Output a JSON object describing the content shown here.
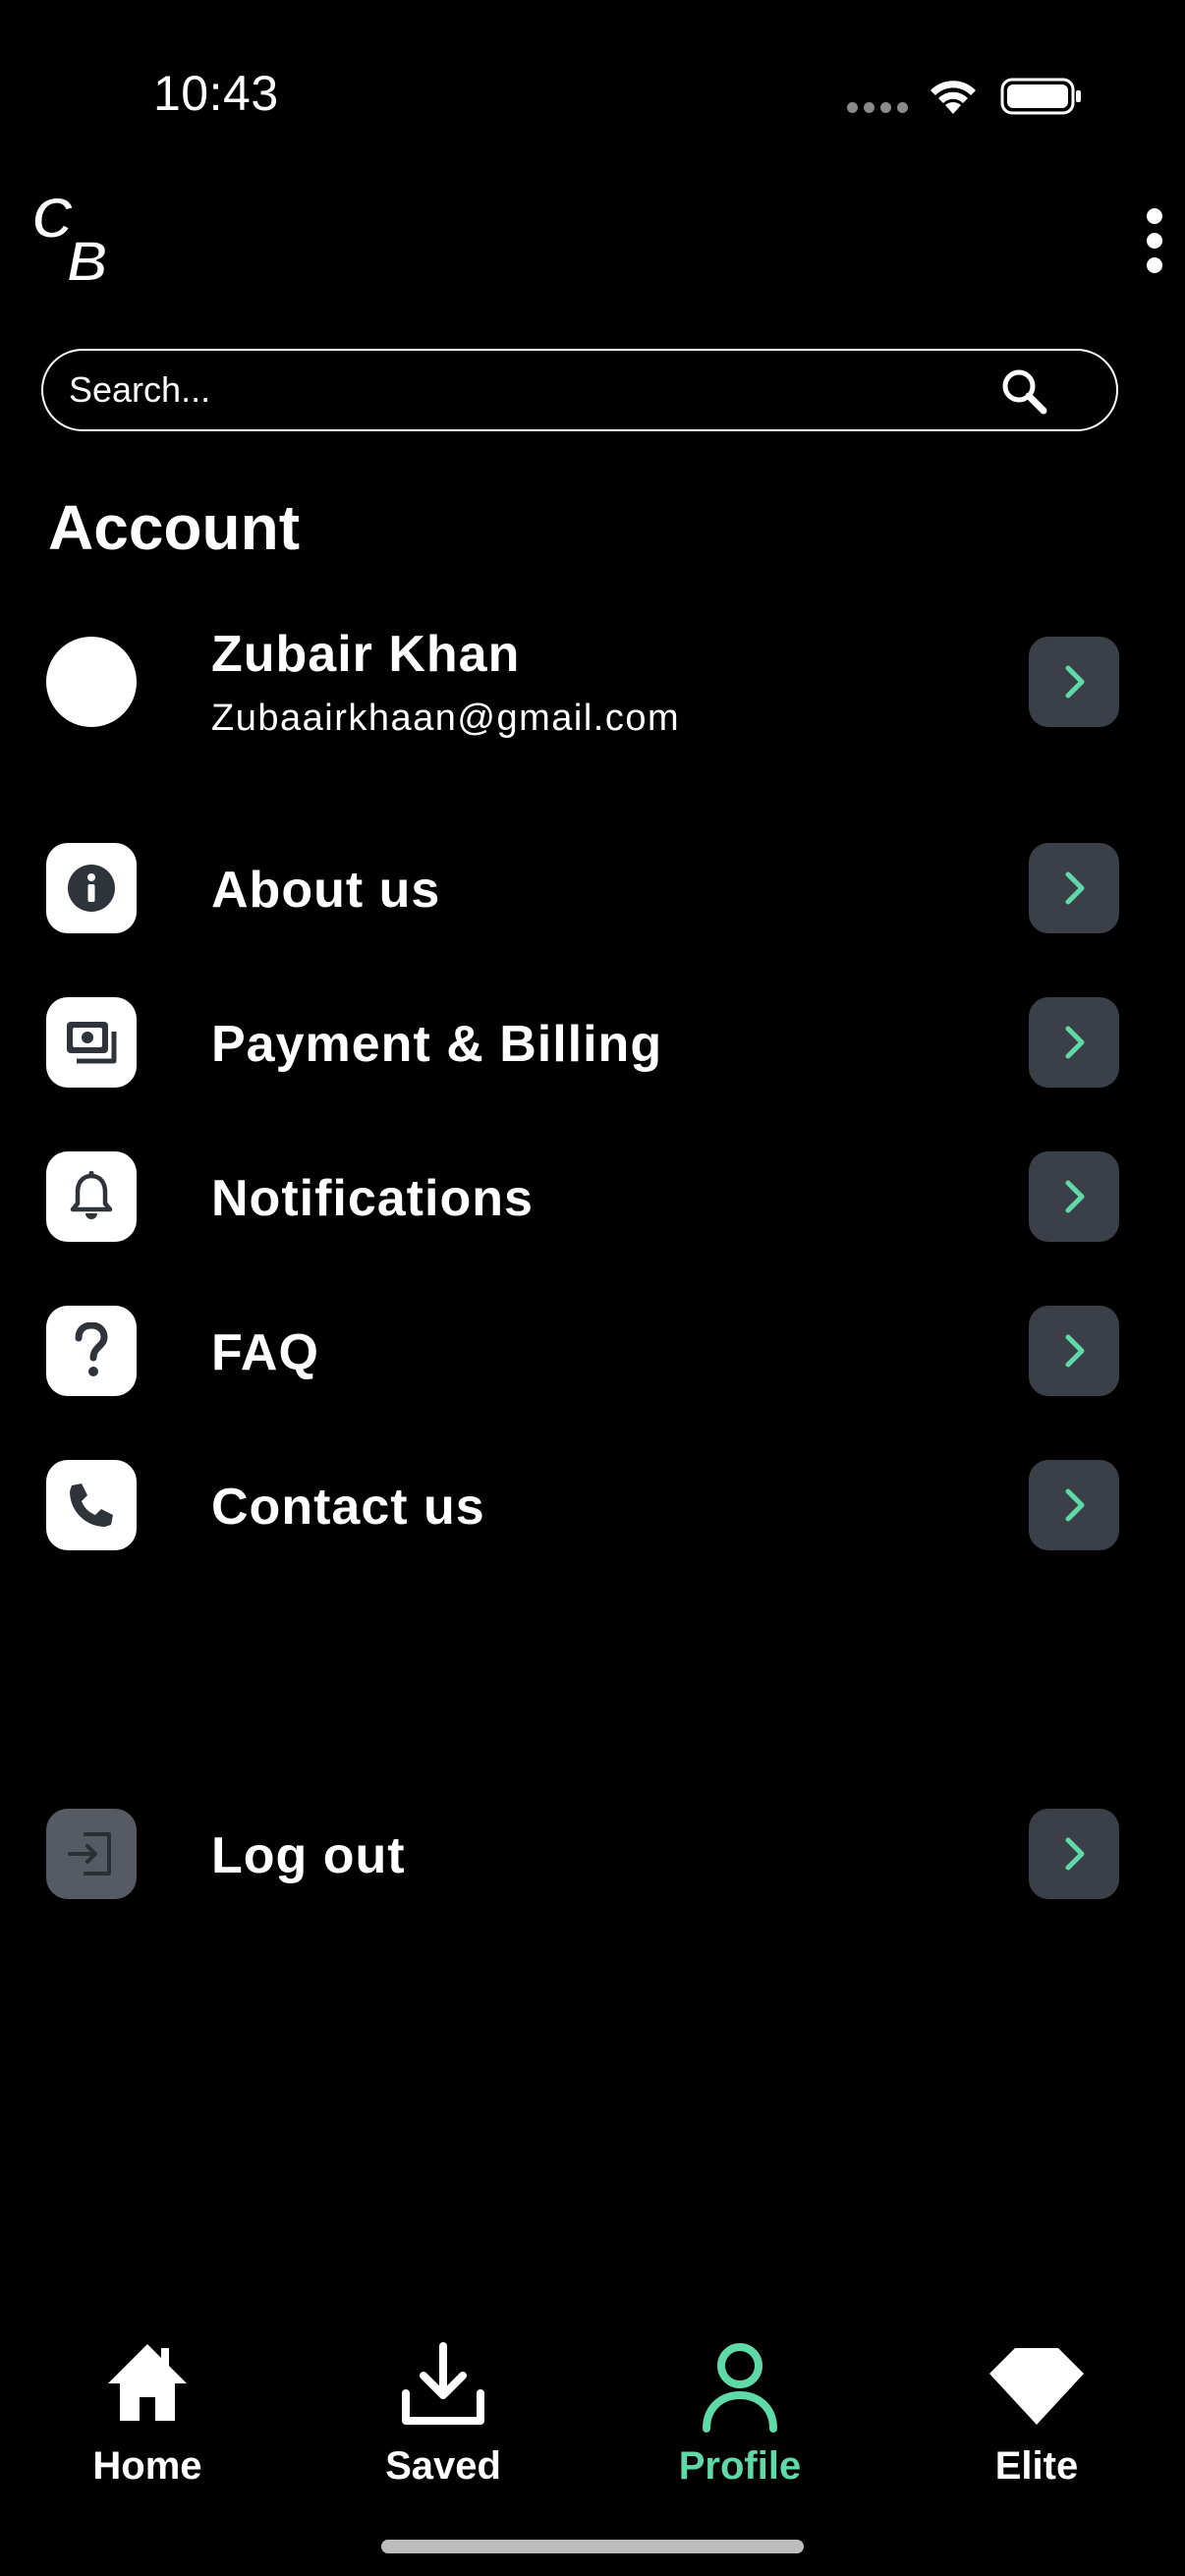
{
  "status_bar": {
    "time": "10:43"
  },
  "header": {
    "logo_icon": "cb-logo-icon",
    "more_icon": "more-vertical-icon"
  },
  "search": {
    "placeholder": "Search..."
  },
  "section": {
    "title": "Account"
  },
  "profile": {
    "name": "Zubair Khan",
    "email": "Zubaairkhaan@gmail.com"
  },
  "menu": {
    "items": [
      {
        "label": "About us",
        "icon": "info-icon"
      },
      {
        "label": "Payment & Billing",
        "icon": "payment-icon"
      },
      {
        "label": "Notifications",
        "icon": "bell-icon"
      },
      {
        "label": "FAQ",
        "icon": "question-icon"
      },
      {
        "label": "Contact us",
        "icon": "phone-icon"
      }
    ],
    "logout": {
      "label": "Log out",
      "icon": "logout-icon"
    }
  },
  "tab_bar": {
    "tabs": [
      {
        "label": "Home",
        "icon": "home-icon"
      },
      {
        "label": "Saved",
        "icon": "download-icon"
      },
      {
        "label": "Profile",
        "icon": "user-icon",
        "active": true
      },
      {
        "label": "Elite",
        "icon": "diamond-icon"
      }
    ]
  },
  "colors": {
    "background": "#000000",
    "accent": "#5fd9a8",
    "chevron_bg": "#3b4048",
    "icon_tile": "#ffffff",
    "logout_tile": "#555a63"
  }
}
